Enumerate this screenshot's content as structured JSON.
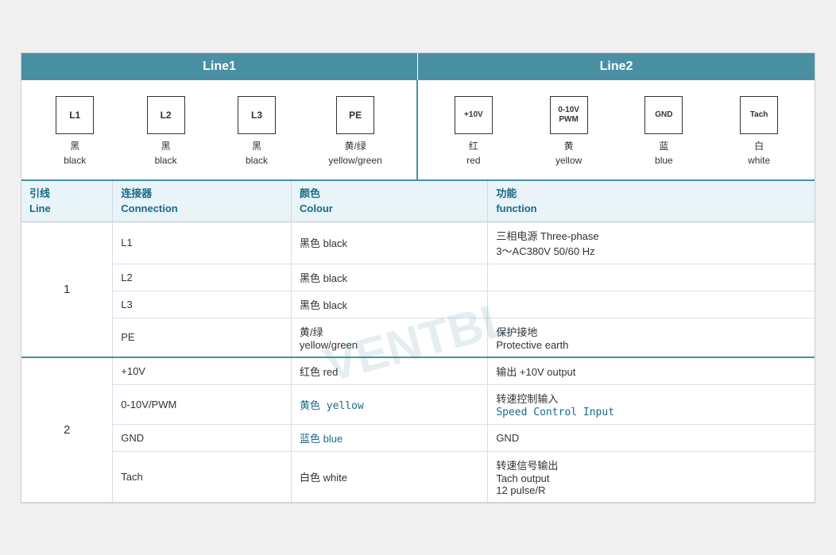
{
  "header": {
    "line1_label": "Line1",
    "line2_label": "Line2"
  },
  "line1_connectors": [
    {
      "id": "L1",
      "chinese": "黑",
      "english": "black"
    },
    {
      "id": "L2",
      "chinese": "黑",
      "english": "black"
    },
    {
      "id": "L3",
      "chinese": "黑",
      "english": "black"
    },
    {
      "id": "PE",
      "chinese": "黄/绿",
      "english": "yellow/green"
    }
  ],
  "line2_connectors": [
    {
      "id": "+10V",
      "chinese": "红",
      "english": "red"
    },
    {
      "id": "0-10V\nPWM",
      "chinese": "黄",
      "english": "yellow"
    },
    {
      "id": "GND",
      "chinese": "蓝",
      "english": "blue"
    },
    {
      "id": "Tach",
      "chinese": "白",
      "english": "white"
    }
  ],
  "table_headers": {
    "line": "引线\nLine",
    "connection": "连接器\nConnection",
    "colour": "颜色\nColour",
    "function": "功能\nfunction"
  },
  "table_rows": [
    {
      "line_group": "1",
      "sub_rows": [
        {
          "connection": "L1",
          "colour": "黑色 black",
          "function": "三相电源 Three-phase\n3～AC380V 50/60 Hz",
          "rowspan": 3
        },
        {
          "connection": "L2",
          "colour": "黑色 black",
          "function": ""
        },
        {
          "connection": "L3",
          "colour": "黑色 black",
          "function": ""
        },
        {
          "connection": "PE",
          "colour": "黄/绿\nyellow/green",
          "function": "保护接地\nProtective earth"
        }
      ]
    },
    {
      "line_group": "2",
      "sub_rows": [
        {
          "connection": "+10V",
          "colour": "红色 red",
          "function": "输出 +10V output"
        },
        {
          "connection": "0-10V/PWM",
          "colour": "黄色 yellow",
          "function": "转速控制输入\nSpeed Control Input"
        },
        {
          "connection": "GND",
          "colour": "蓝色 blue",
          "function": "GND"
        },
        {
          "connection": "Tach",
          "colour": "白色 white",
          "function": "转速信号输出\nTach output\n12 pulse/R"
        }
      ]
    }
  ],
  "watermark": "VENTBL"
}
